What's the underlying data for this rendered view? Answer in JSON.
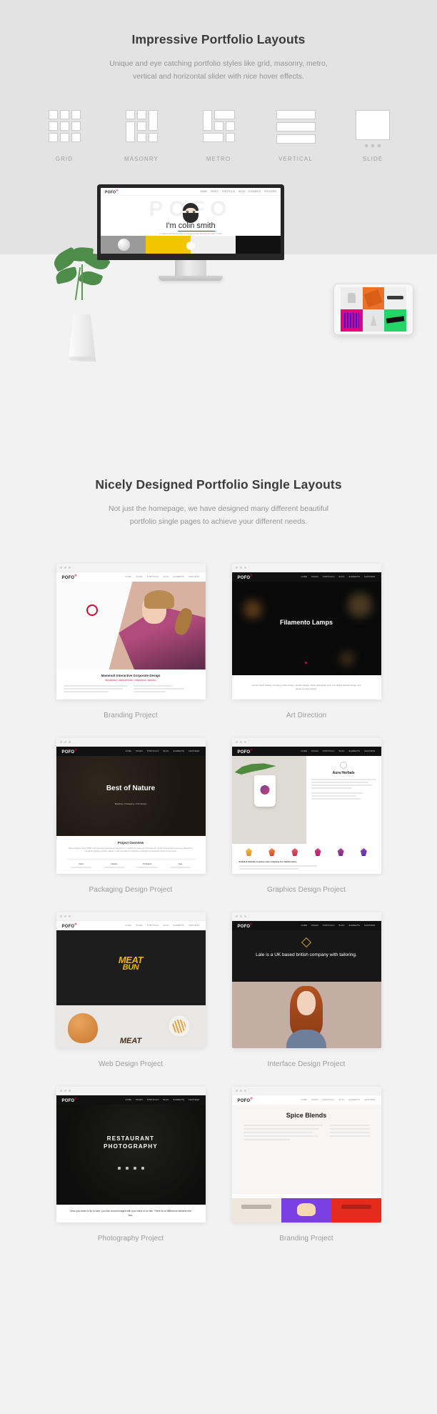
{
  "section_layouts": {
    "title": "Impressive Portfolio Layouts",
    "subtitle": "Unique and eye catching portfolio styles like grid, masonry, metro, vertical and horizontal slider with nice hover effects.",
    "icons": [
      {
        "label": "GRID",
        "kind": "grid-layout-icon"
      },
      {
        "label": "MASONRY",
        "kind": "masonry-layout-icon"
      },
      {
        "label": "METRO",
        "kind": "metro-layout-icon"
      },
      {
        "label": "VERTICAL",
        "kind": "vertical-layout-icon"
      },
      {
        "label": "SLIDE",
        "kind": "slide-layout-icon"
      }
    ]
  },
  "mockup": {
    "monitor": {
      "logo": "POFO",
      "logo_mark": "®",
      "nav": [
        "HOME",
        "PAGES",
        "PORTFOLIO",
        "BLOG",
        "ELEMENTS",
        "FEATURES"
      ],
      "ghost_text": "POFO",
      "hero_line_plain": "I'm ",
      "hero_line_underlined": "colin smith",
      "hero_tagline": "A CREATIVE DESIGNER & DEVELOPER BASED IN NEW YORK"
    }
  },
  "section_portfolio": {
    "title": "Nicely Designed Portfolio Single Layouts",
    "subtitle": "Not just the homepage, we have designed many different beautiful portfolio single pages to achieve your different needs.",
    "cards": [
      {
        "caption": "Branding Project",
        "logo": "POFO",
        "nav": [
          "HOME",
          "PAGES",
          "PORTFOLIO",
          "BLOG",
          "ELEMENTS",
          "FEATURES"
        ],
        "foot_title": "Mammutt Interactive Corporate Design",
        "foot_sub": "BRANDING / INNOVATIONS / OPENINGS / DESIGN"
      },
      {
        "caption": "Art Direction",
        "logo": "POFO",
        "nav": [
          "HOME",
          "PAGES",
          "PORTFOLIO",
          "BLOG",
          "ELEMENTS",
          "FEATURES"
        ],
        "hero_title": "Filamento Lamps",
        "hero_sub": "nombre brand redesign focusing product design, interface design, studio photograph style, icon design editorial design, web design & motion design.",
        "foot_sub": ""
      },
      {
        "caption": "Packaging Design Project",
        "logo": "POFO",
        "nav": [
          "HOME",
          "PAGES",
          "PORTFOLIO",
          "BLOG",
          "ELEMENTS",
          "FEATURES"
        ],
        "hero_title": "Best of Nature",
        "hero_sub": "Branding  •  Packaging  •  Print Design",
        "foot_title": "Project Overview",
        "foot_sub": "Best of Nature, short RAW, only uses the most natural ingredients in traditional recipes for its finest oils, herbal mixtures and essences, that with a constantly growing product palette, it was important to establish a strategic and aesthetic focus for the brand.",
        "meta": [
          "Client",
          "Industry",
          "Art Director",
          "Year"
        ]
      },
      {
        "caption": "Graphics Design Project",
        "logo": "POFO",
        "nav": [
          "HOME",
          "PAGES",
          "PORTFOLIO",
          "BLOG",
          "ELEMENTS",
          "FEATURES"
        ],
        "hero_title": "Aura Herbals",
        "foot_title": "Brand & website to prime new company for market entry."
      },
      {
        "caption": "Web Design Project",
        "logo": "POFO",
        "nav": [
          "HOME",
          "PAGES",
          "PORTFOLIO",
          "BLOG",
          "ELEMENTS",
          "FEATURES"
        ],
        "hero_title": "MEAT",
        "hero_title_2": "BUN"
      },
      {
        "caption": "Interface Design Project",
        "logo": "POFO",
        "nav": [
          "HOME",
          "PAGES",
          "PORTFOLIO",
          "BLOG",
          "ELEMENTS",
          "FEATURES"
        ],
        "hero_title": "Lale is a UK based british company with tailoring."
      },
      {
        "caption": "Photography Project",
        "logo": "POFO",
        "nav": [
          "HOME",
          "PAGES",
          "PORTFOLIO",
          "BLOG",
          "ELEMENTS",
          "FEATURES"
        ],
        "hero_title": "RESTAURANT",
        "hero_title_2": "PHOTOGRAPHY",
        "quote": "Once you learn to fly to care, you can record images with your mind or on film. There is no difference between the two."
      },
      {
        "caption": "Branding Project",
        "logo": "POFO",
        "nav": [
          "HOME",
          "PAGES",
          "PORTFOLIO",
          "BLOG",
          "ELEMENTS",
          "FEATURES"
        ],
        "hero_title": "Spice Blends"
      }
    ]
  },
  "colors": {
    "section_bg_top": "#e3e3e3",
    "section_bg_bottom": "#f2f2f2",
    "accent_red": "#e0002c",
    "heading": "#3b3b3b",
    "muted": "#9a9a9a"
  }
}
